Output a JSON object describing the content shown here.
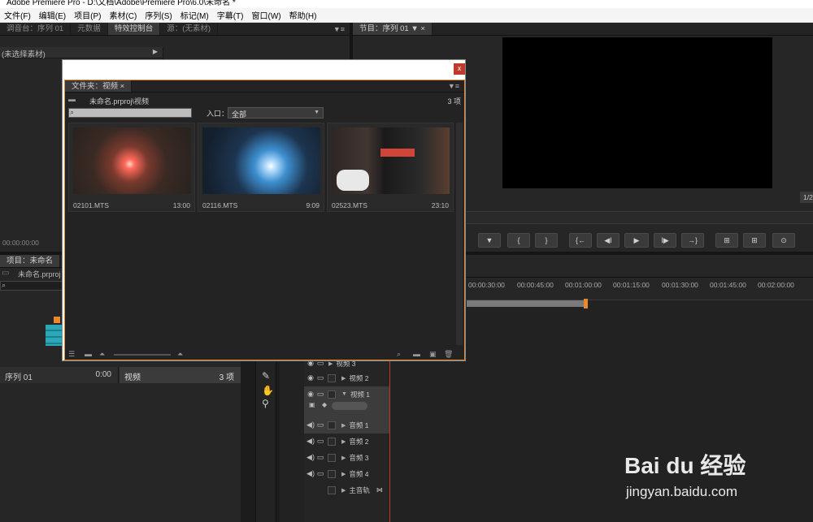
{
  "app": {
    "title": "Adobe Premiere Pro - D:\\文档\\Adobe\\Premiere Pro\\6.0\\未命名 *"
  },
  "menu": [
    "文件(F)",
    "编辑(E)",
    "项目(P)",
    "素材(C)",
    "序列(S)",
    "标记(M)",
    "字幕(T)",
    "窗口(W)",
    "帮助(H)"
  ],
  "source_panel": {
    "tabs": [
      "调音台：序列 01",
      "元数据",
      "特效控制台",
      "源：(无素材)"
    ],
    "no_clip": "(未选择素材)",
    "timecode": "00:00:00:00"
  },
  "program_panel": {
    "tab": "节目：序列 01",
    "fraction": "1/2",
    "transport": [
      "▼",
      "{",
      "}",
      "{←",
      "◀I",
      "▶",
      "I▶",
      "→}",
      "⊞",
      "⊞",
      "⊙"
    ]
  },
  "project_panel": {
    "tab": "项目：未命名",
    "file": "未命名.prproj",
    "search_icon": "magnifier",
    "rows": [
      {
        "name": "序列 01",
        "duration": "0:00"
      },
      {
        "name": "视频",
        "count": "3 项"
      }
    ]
  },
  "timeline": {
    "ruler": [
      "00:00:30:00",
      "00:00:45:00",
      "00:01:00:00",
      "00:01:15:00",
      "00:01:30:00",
      "00:01:45:00",
      "00:02:00:00"
    ],
    "tracks": [
      {
        "label": "视频 3",
        "type": "video"
      },
      {
        "label": "视频 2",
        "type": "video"
      },
      {
        "label": "视频 1",
        "type": "video"
      },
      {
        "label": "音频 1",
        "type": "audio"
      },
      {
        "label": "音频 2",
        "type": "audio"
      },
      {
        "label": "音频 3",
        "type": "audio"
      },
      {
        "label": "音频 4",
        "type": "audio"
      },
      {
        "label": "主音轨",
        "type": "master"
      }
    ],
    "tools": [
      "pen-icon",
      "hand-icon",
      "zoom-icon"
    ]
  },
  "bin": {
    "close_label": "x",
    "tab": "文件夹：视频",
    "path": "未命名.prproj\\视频",
    "count": "3 项",
    "entry_label": "入口：",
    "entry_value": "全部",
    "clips": [
      {
        "name": "02101.MTS",
        "duration": "13:00"
      },
      {
        "name": "02116.MTS",
        "duration": "9:09"
      },
      {
        "name": "02523.MTS",
        "duration": "23:10"
      }
    ]
  },
  "watermark": {
    "brand": "Bai du 经验",
    "url": "jingyan.baidu.com"
  },
  "colors": {
    "accent": "#e8892e",
    "playhead": "#c0392b",
    "close": "#c0392b",
    "background": "#1c1c1c"
  }
}
